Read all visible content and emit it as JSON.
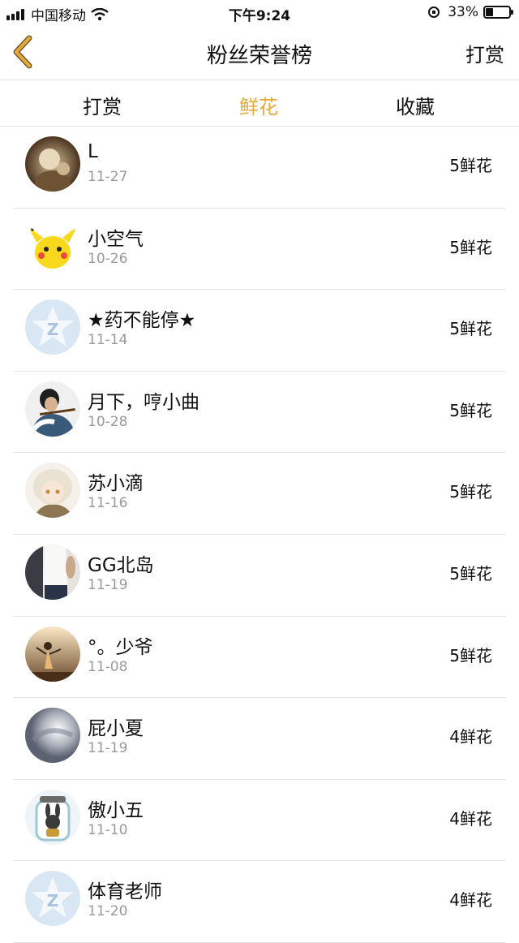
{
  "status_bar": {
    "carrier": "中国移动",
    "time": "下午9:24",
    "battery": "33%",
    "battery_level": 0.33
  },
  "nav": {
    "title": "粉丝荣誉榜",
    "right_button": "打赏",
    "back_icon": "chevron-left-icon",
    "accent_color": "#E9A83A"
  },
  "tabs": [
    {
      "label": "打赏",
      "active": false
    },
    {
      "label": "鲜花",
      "active": true
    },
    {
      "label": "收藏",
      "active": false
    }
  ],
  "fans": [
    {
      "name": "L",
      "date": "11-27",
      "count": "5鲜花",
      "avatar": "photo-sepia"
    },
    {
      "name": "小空气",
      "date": "10-26",
      "count": "5鲜花",
      "avatar": "pikachu"
    },
    {
      "name": "★药不能停★",
      "date": "11-14",
      "count": "5鲜花",
      "avatar": "qq-default"
    },
    {
      "name": "月下，哼小曲",
      "date": "10-28",
      "count": "5鲜花",
      "avatar": "flute-player"
    },
    {
      "name": "苏小滴",
      "date": "11-16",
      "count": "5鲜花",
      "avatar": "anime-girl"
    },
    {
      "name": "GG北岛",
      "date": "11-19",
      "count": "5鲜花",
      "avatar": "girl-white-shirt"
    },
    {
      "name": "°。少爷",
      "date": "11-08",
      "count": "5鲜花",
      "avatar": "sunset-dancer"
    },
    {
      "name": "屁小夏",
      "date": "11-19",
      "count": "4鲜花",
      "avatar": "grey-blur"
    },
    {
      "name": "傲小五",
      "date": "11-10",
      "count": "4鲜花",
      "avatar": "bunny-jar"
    },
    {
      "name": "体育老师",
      "date": "11-20",
      "count": "4鲜花",
      "avatar": "qq-default"
    }
  ]
}
